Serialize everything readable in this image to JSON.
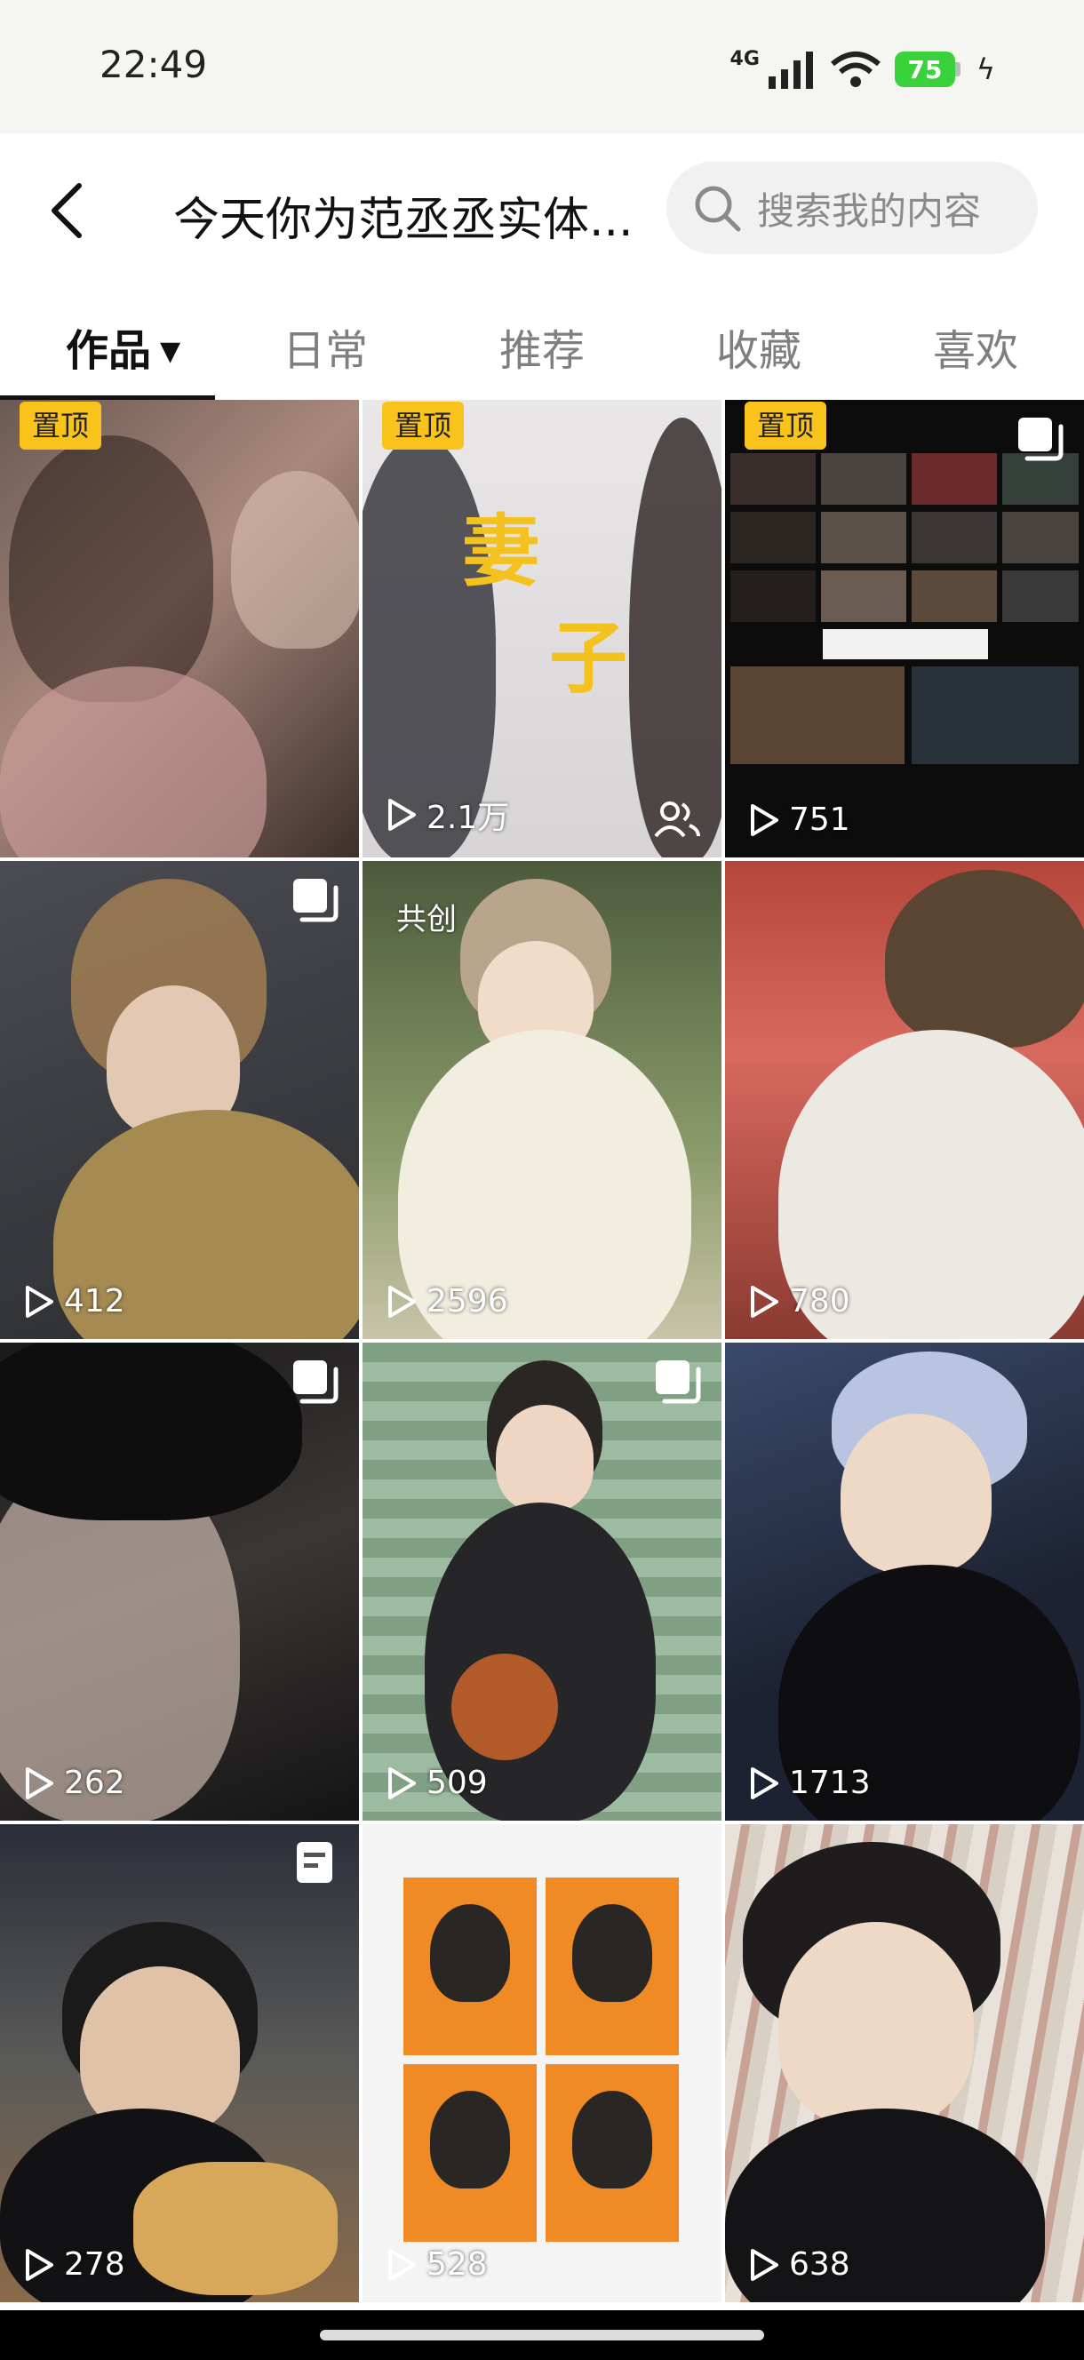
{
  "status_bar": {
    "time": "22:49",
    "network": "4G",
    "battery": "75"
  },
  "header": {
    "title": "今天你为范丞丞实体...",
    "search_placeholder": "搜索我的内容"
  },
  "tabs": [
    {
      "label": "作品",
      "active": true
    },
    {
      "label": "日常",
      "active": false
    },
    {
      "label": "推荐",
      "active": false
    },
    {
      "label": "收藏",
      "active": false
    },
    {
      "label": "喜欢",
      "active": false
    }
  ],
  "grid": [
    {
      "badge": "置顶",
      "plays": ""
    },
    {
      "badge": "置顶",
      "plays": "2.1万",
      "overlay_text": [
        "妻",
        "子"
      ]
    },
    {
      "badge": "置顶",
      "plays": "751"
    },
    {
      "badge": "",
      "plays": "412"
    },
    {
      "badge": "共创",
      "plays": "2596"
    },
    {
      "badge": "",
      "plays": "780"
    },
    {
      "badge": "",
      "plays": "262"
    },
    {
      "badge": "",
      "plays": "509"
    },
    {
      "badge": "",
      "plays": "1713"
    },
    {
      "badge": "",
      "plays": "278"
    },
    {
      "badge": "",
      "plays": "528"
    },
    {
      "badge": "",
      "plays": "638"
    }
  ],
  "colors": {
    "pin_badge": "#f9c31c",
    "battery": "#3ad23a",
    "tab_active": "#111111",
    "tab_inactive": "#7f7f7f"
  }
}
